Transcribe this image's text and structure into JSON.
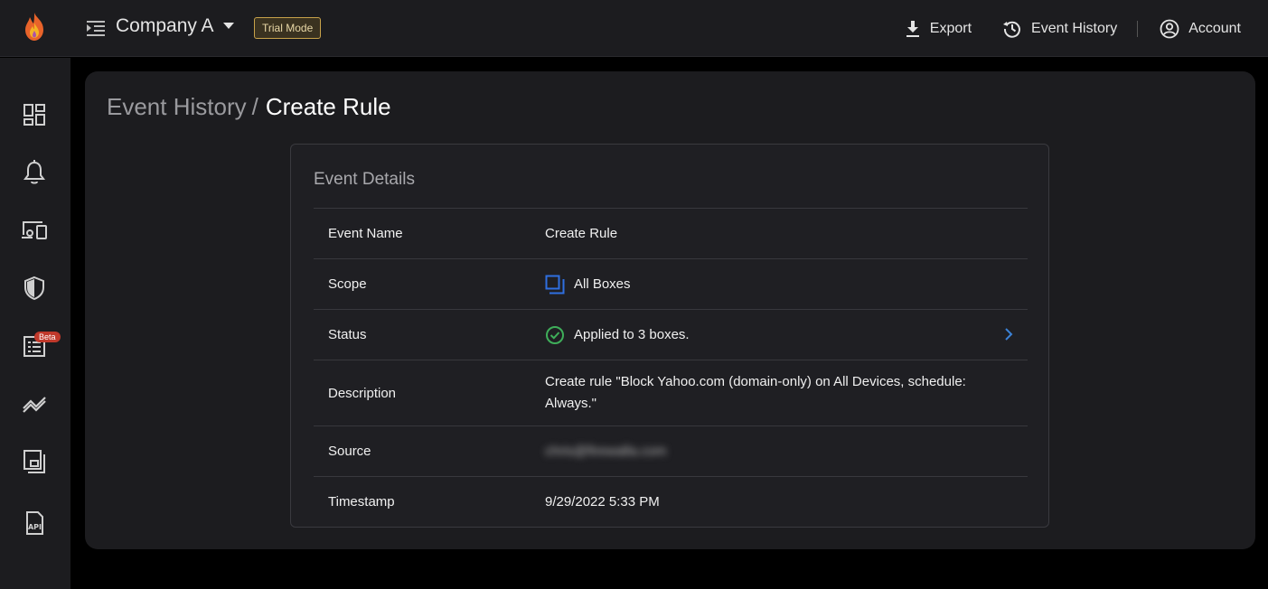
{
  "header": {
    "company": "Company A",
    "trial_badge": "Trial Mode",
    "export_label": "Export",
    "event_history_label": "Event History",
    "account_label": "Account"
  },
  "sidebar": {
    "items": [
      {
        "icon": "dashboard-icon"
      },
      {
        "icon": "bell-icon"
      },
      {
        "icon": "devices-icon"
      },
      {
        "icon": "shield-icon"
      },
      {
        "icon": "list-icon",
        "badge": "Beta"
      },
      {
        "icon": "trends-icon"
      },
      {
        "icon": "boxes-icon"
      },
      {
        "icon": "api-icon"
      }
    ]
  },
  "breadcrumb": {
    "parent": "Event History",
    "separator": "/",
    "current": "Create Rule"
  },
  "card": {
    "title": "Event Details",
    "rows": [
      {
        "label": "Event Name",
        "value": "Create Rule"
      },
      {
        "label": "Scope",
        "value": "All Boxes",
        "icon": "boxes-scope-icon"
      },
      {
        "label": "Status",
        "value": "Applied to 3 boxes.",
        "icon": "check-circle-icon"
      },
      {
        "label": "Description",
        "value": "Create rule \"Block Yahoo.com (domain-only) on All Devices, schedule: Always.\""
      },
      {
        "label": "Source",
        "value": "chris@firewalla.com"
      },
      {
        "label": "Timestamp",
        "value": "9/29/2022 5:33 PM"
      }
    ]
  },
  "colors": {
    "accent_blue": "#2f6fe0",
    "success_green": "#3fae5a",
    "trial_gold": "#c8a24a",
    "beta_red": "#c0392b"
  }
}
